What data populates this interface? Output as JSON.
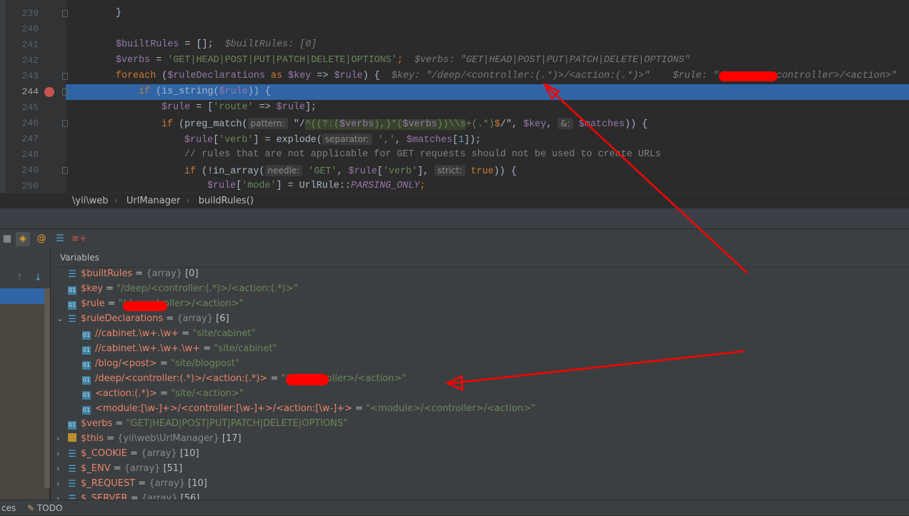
{
  "editor": {
    "current_line": 244,
    "lines": [
      {
        "n": 239,
        "indent": 2,
        "t": [
          [
            "}",
            ""
          ]
        ]
      },
      {
        "n": 240,
        "indent": 2,
        "t": []
      },
      {
        "n": 241,
        "indent": 2,
        "t": [
          [
            "$builtRules",
            "var"
          ],
          [
            " = [];",
            ""
          ],
          [
            "  $builtRules: [0]",
            "hint"
          ]
        ]
      },
      {
        "n": 242,
        "indent": 2,
        "t": [
          [
            "$verbs",
            "var"
          ],
          [
            " = ",
            ""
          ],
          [
            "'GET|HEAD|POST|PUT|PATCH|DELETE|OPTIONS'",
            "str"
          ],
          [
            ";",
            "kw"
          ],
          [
            "  $verbs: \"GET|HEAD|POST|PUT|PATCH|DELETE|OPTIONS\"",
            "hint"
          ]
        ]
      },
      {
        "n": 243,
        "indent": 2,
        "t": [
          [
            "foreach",
            "kw"
          ],
          [
            " (",
            ""
          ],
          [
            "$ruleDeclarations",
            "var"
          ],
          [
            " as ",
            "kw"
          ],
          [
            "$key",
            "var"
          ],
          [
            " => ",
            ""
          ],
          [
            "$rule",
            "var"
          ],
          [
            ") {",
            ""
          ],
          [
            "  $key: \"/deep/<controller:(.*)>/<action:(.*)>\"    $rule: \"/",
            "hint"
          ],
          [
            "        <controller>/<action>\"",
            "hint"
          ]
        ]
      },
      {
        "n": 244,
        "indent": 3,
        "t": [
          [
            "if",
            "kw"
          ],
          [
            " (is_string(",
            ""
          ],
          [
            "$rule",
            "var"
          ],
          [
            ")) {",
            ""
          ]
        ]
      },
      {
        "n": 245,
        "indent": 4,
        "t": [
          [
            "$rule",
            "var"
          ],
          [
            " = [",
            ""
          ],
          [
            "'route'",
            "str"
          ],
          [
            " => ",
            ""
          ],
          [
            "$rule",
            "var"
          ],
          [
            "];",
            ""
          ]
        ]
      },
      {
        "n": 246,
        "indent": 4,
        "t": [
          [
            "if",
            "kw"
          ],
          [
            " (preg_match(",
            ""
          ],
          [
            "pattern:",
            "param"
          ],
          [
            " \"/",
            ""
          ],
          [
            "^((?:(",
            "str rx"
          ],
          [
            "$verbs",
            "var rx"
          ],
          [
            "),)*(",
            "str rx"
          ],
          [
            "$verbs",
            "var rx"
          ],
          [
            "))\\\\s",
            "str rx"
          ],
          [
            "+(.*)",
            "str"
          ],
          [
            "$",
            "kw"
          ],
          [
            "/\", ",
            ""
          ],
          [
            "$key",
            "var"
          ],
          [
            ", ",
            ""
          ],
          [
            "&:",
            "param"
          ],
          [
            " $matches",
            "var"
          ],
          [
            ")) {",
            ""
          ]
        ]
      },
      {
        "n": 247,
        "indent": 5,
        "t": [
          [
            "$rule",
            "var"
          ],
          [
            "[",
            ""
          ],
          [
            "'verb'",
            "str"
          ],
          [
            "] = explode(",
            ""
          ],
          [
            "separator:",
            "param"
          ],
          [
            " ','",
            "str"
          ],
          [
            ", ",
            ""
          ],
          [
            "$matches",
            "var"
          ],
          [
            "[",
            ""
          ],
          [
            "1",
            "num"
          ],
          [
            "]);",
            ""
          ]
        ]
      },
      {
        "n": 248,
        "indent": 5,
        "t": [
          [
            "// rules that are not applicable for GET requests should not be used to create URLs",
            "cm"
          ]
        ]
      },
      {
        "n": 249,
        "indent": 5,
        "t": [
          [
            "if",
            "kw"
          ],
          [
            " (!in_array(",
            ""
          ],
          [
            "needle:",
            "param"
          ],
          [
            " 'GET'",
            "str"
          ],
          [
            ", ",
            ""
          ],
          [
            "$rule",
            "var"
          ],
          [
            "[",
            ""
          ],
          [
            "'verb'",
            "str"
          ],
          [
            "], ",
            ""
          ],
          [
            "strict:",
            "param"
          ],
          [
            " true",
            "kw"
          ],
          [
            ")) {",
            ""
          ]
        ]
      },
      {
        "n": 250,
        "indent": 6,
        "t": [
          [
            "$rule",
            "var"
          ],
          [
            "[",
            ""
          ],
          [
            "'mode'",
            "str"
          ],
          [
            "] = UrlRule::",
            ""
          ],
          [
            "PARSING_ONLY",
            "const"
          ],
          [
            ";",
            "kw"
          ]
        ]
      }
    ]
  },
  "breadcrumb": [
    "\\yii\\web",
    "UrlManager",
    "buildRules()"
  ],
  "debugger": {
    "panel_title": "Variables",
    "variables": [
      {
        "level": 0,
        "expand": "",
        "icon": "array",
        "name": "$builtRules",
        "type": "{array}",
        "value": "[0]"
      },
      {
        "level": 0,
        "expand": "",
        "icon": "prim",
        "name": "$key",
        "value": "\"/deep/<controller:(.*)>/<action:(.*)>\""
      },
      {
        "level": 0,
        "expand": "",
        "icon": "prim",
        "name": "$rule",
        "value": "\"/        /<controller>/<action>\"",
        "redacted": true
      },
      {
        "level": 0,
        "expand": "⌄",
        "icon": "array",
        "name": "$ruleDeclarations",
        "type": "{array}",
        "value": "[6]"
      },
      {
        "level": 1,
        "expand": "",
        "icon": "prim",
        "name": "//cabinet.\\w+.\\w+",
        "value": "\"site/cabinet\""
      },
      {
        "level": 1,
        "expand": "",
        "icon": "prim",
        "name": "//cabinet.\\w+.\\w+.\\w+",
        "value": "\"site/cabinet\""
      },
      {
        "level": 1,
        "expand": "",
        "icon": "prim",
        "name": "/blog/<post>",
        "value": "\"site/blogpost\""
      },
      {
        "level": 1,
        "expand": "",
        "icon": "prim",
        "name": "/deep/<controller:(.*)>/<action:(.*)>",
        "value": "\"/        /<controller>/<action>\"",
        "redacted": true
      },
      {
        "level": 1,
        "expand": "",
        "icon": "prim",
        "name": "<action:(.*)>",
        "value": "\"site/<action>\""
      },
      {
        "level": 1,
        "expand": "",
        "icon": "prim",
        "name": "<module:[\\w-]+>/<controller:[\\w-]+>/<action:[\\w-]+>",
        "value": "\"<module>/<controller>/<action>\""
      },
      {
        "level": 0,
        "expand": "",
        "icon": "prim",
        "name": "$verbs",
        "value": "\"GET|HEAD|POST|PUT|PATCH|DELETE|OPTIONS\""
      },
      {
        "level": 0,
        "expand": "›",
        "icon": "obj",
        "name": "$this",
        "type": "{yii\\web\\UrlManager}",
        "value": "[17]"
      },
      {
        "level": 0,
        "expand": "›",
        "icon": "array",
        "name": "$_COOKIE",
        "type": "{array}",
        "value": "[10]"
      },
      {
        "level": 0,
        "expand": "›",
        "icon": "array",
        "name": "$_ENV",
        "type": "{array}",
        "value": "[51]"
      },
      {
        "level": 0,
        "expand": "›",
        "icon": "array",
        "name": "$_REQUEST",
        "type": "{array}",
        "value": "[10]"
      },
      {
        "level": 0,
        "expand": "›",
        "icon": "array",
        "name": "$_SERVER",
        "type": "{array}",
        "value": "[56]"
      }
    ]
  },
  "status": {
    "left_fragment": "ces",
    "todo": "TODO"
  },
  "colors": {
    "selection": "#2f65a5",
    "annotation": "#ff0000"
  }
}
